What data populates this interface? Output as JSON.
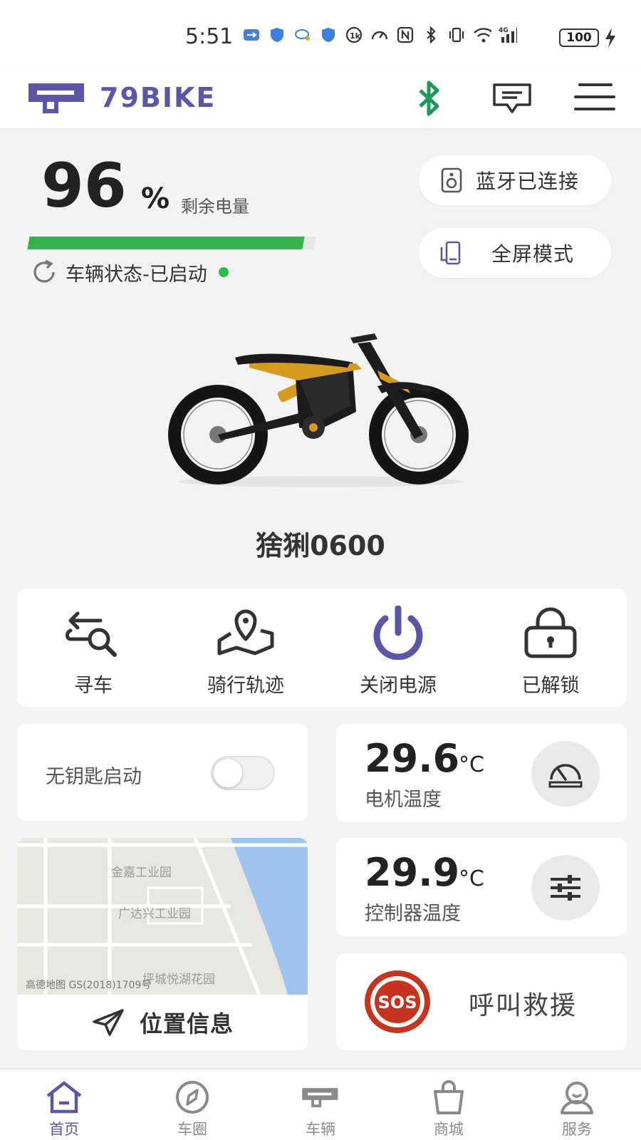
{
  "status_bar": {
    "time": "5:51",
    "battery": "100",
    "icons": [
      "usb-icon",
      "shield-icon",
      "chat-icon",
      "shield-icon",
      "hd-icon",
      "speed-icon",
      "nfc-icon",
      "bluetooth-icon",
      "vibrate-icon",
      "wifi-icon",
      "signal-4g-icon"
    ]
  },
  "header": {
    "brand": "79BIKE"
  },
  "battery": {
    "percent": "96",
    "percent_symbol": "%",
    "label": "剩余电量",
    "level": 0.96,
    "bar_color": "#34b24e"
  },
  "vehicle": {
    "status": "车辆状态-已启动",
    "name": "猞猁0600"
  },
  "pills": {
    "bluetooth": "蓝牙已连接",
    "fullscreen": "全屏模式"
  },
  "actions": [
    {
      "label": "寻车",
      "icon": "find-car-icon"
    },
    {
      "label": "骑行轨迹",
      "icon": "route-icon"
    },
    {
      "label": "关闭电源",
      "icon": "power-icon"
    },
    {
      "label": "已解锁",
      "icon": "lock-icon"
    }
  ],
  "keyless": {
    "label": "无钥匙启动",
    "enabled": false
  },
  "motor_temp": {
    "value": "29.6",
    "unit": "°C",
    "label": "电机温度"
  },
  "controller_temp": {
    "value": "29.9",
    "unit": "°C",
    "label": "控制器温度"
  },
  "map": {
    "labels": [
      "金嘉工业园",
      "广达兴工业园",
      "坪城悦湖花园"
    ],
    "attribution": "高德地图 GS(2018)1709号",
    "footer": "位置信息"
  },
  "sos": {
    "badge": "SOS",
    "label": "呼叫救援"
  },
  "nav": [
    {
      "label": "首页",
      "icon": "home-icon",
      "active": true
    },
    {
      "label": "车圈",
      "icon": "compass-icon",
      "active": false
    },
    {
      "label": "车辆",
      "icon": "vehicle-icon",
      "active": false
    },
    {
      "label": "商城",
      "icon": "shopping-bag-icon",
      "active": false
    },
    {
      "label": "服务",
      "icon": "user-service-icon",
      "active": false
    }
  ],
  "colors": {
    "brand": "#5a57a8",
    "bluetooth": "#1c9a5a",
    "battery": "#34b24e",
    "sos": "#c8331f"
  }
}
